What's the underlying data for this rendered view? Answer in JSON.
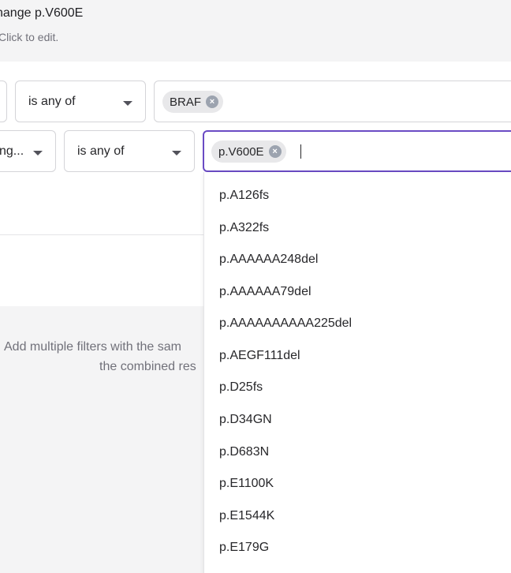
{
  "header": {
    "title": "nange p.V600E",
    "subtitle": "Click to edit."
  },
  "filters": {
    "row1": {
      "operator": "is any of",
      "chip": "BRAF"
    },
    "row2": {
      "field": "ng...",
      "operator": "is any of",
      "chip": "p.V600E"
    }
  },
  "hint": {
    "line1": "Add multiple filters with the sam",
    "line2": "the combined res"
  },
  "dropdown": {
    "options": [
      "p.A126fs",
      "p.A322fs",
      "p.AAAAAA248del",
      "p.AAAAAA79del",
      "p.AAAAAAAAAA225del",
      "p.AEGF111del",
      "p.D25fs",
      "p.D34GN",
      "p.D683N",
      "p.E1100K",
      "p.E1544K",
      "p.E179G"
    ]
  },
  "colors": {
    "accent": "#6a4bc4",
    "chip": "#e8e8ea",
    "muted": "#71717a"
  },
  "icons": {
    "remove_chip": "x-circle-icon",
    "dropdown_caret": "chevron-down-icon"
  }
}
